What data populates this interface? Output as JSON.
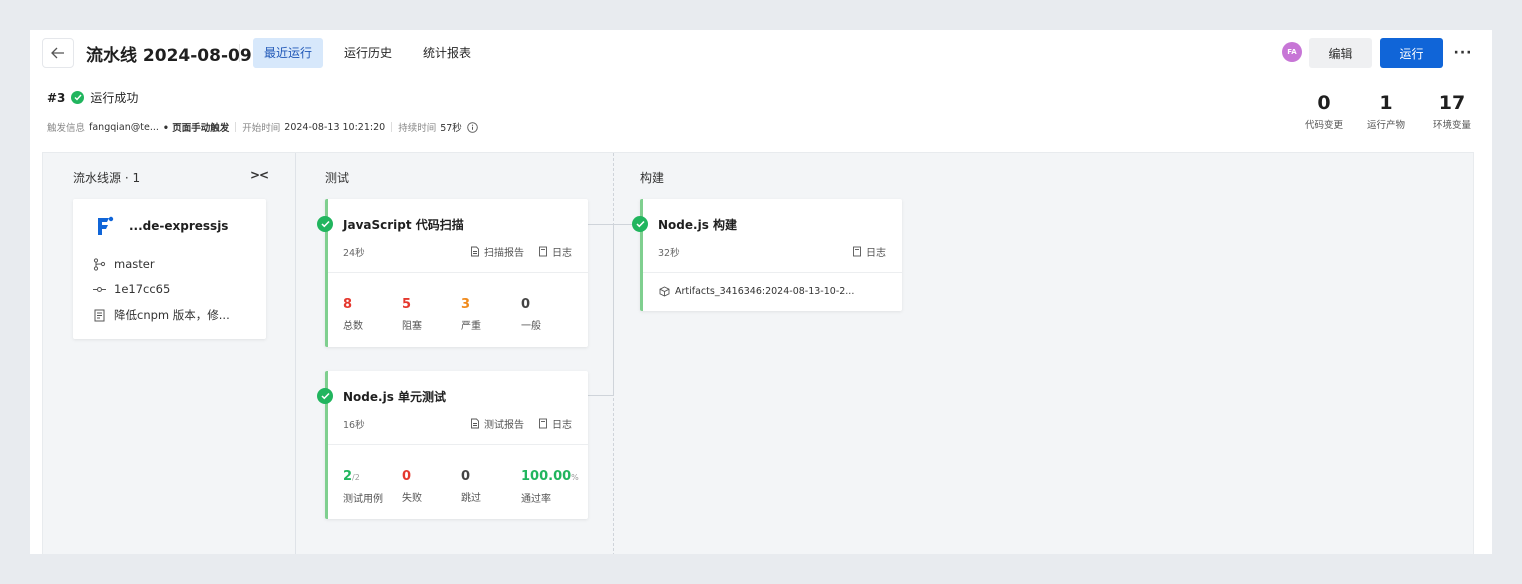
{
  "header": {
    "title": "流水线 2024-08-09",
    "tabs": [
      "最近运行",
      "运行历史",
      "统计报表"
    ],
    "avatar_initials": "FA",
    "edit_label": "编辑",
    "run_label": "运行",
    "more_label": "···"
  },
  "run": {
    "number": "#3",
    "status": "运行成功",
    "trigger_label": "触发信息",
    "trigger_user": "fangqian@te...",
    "trigger_type": "• 页面手动触发",
    "start_label": "开始时间",
    "start_time": "2024-08-13 10:21:20",
    "duration_label": "持续时间",
    "duration": "57秒"
  },
  "stats": [
    {
      "num": "0",
      "label": "代码变更"
    },
    {
      "num": "1",
      "label": "运行产物"
    },
    {
      "num": "17",
      "label": "环境变量"
    }
  ],
  "source": {
    "heading": "流水线源 · 1",
    "collapse": "><",
    "repo": "...de-expressjs",
    "branch": "master",
    "commit": "1e17cc65",
    "message": "降低cnpm 版本，修..."
  },
  "stages": {
    "test": {
      "heading": "测试",
      "js_scan": {
        "title": "JavaScript 代码扫描",
        "duration": "24秒",
        "report": "扫描报告",
        "log": "日志",
        "metrics": [
          {
            "n": "8",
            "t": "总数",
            "color": "#e5382e"
          },
          {
            "n": "5",
            "t": "阻塞",
            "color": "#e5382e"
          },
          {
            "n": "3",
            "t": "严重",
            "color": "#f08a1c"
          },
          {
            "n": "0",
            "t": "一般",
            "color": "#444444"
          }
        ]
      },
      "unit_test": {
        "title": "Node.js 单元测试",
        "duration": "16秒",
        "report": "测试报告",
        "log": "日志",
        "cases": "2",
        "cases_sub": "/2",
        "cases_label": "测试用例",
        "failed": "0",
        "failed_label": "失败",
        "skipped": "0",
        "skipped_label": "跳过",
        "pass_rate": "100.00",
        "pass_unit": "%",
        "pass_label": "通过率"
      }
    },
    "build": {
      "heading": "构建",
      "node_build": {
        "title": "Node.js 构建",
        "duration": "32秒",
        "log": "日志",
        "artifact": "Artifacts_3416346:2024-08-13-10-2..."
      }
    }
  },
  "colors": {
    "primary": "#1065d8",
    "success": "#21b55e",
    "danger": "#e5382e",
    "warning": "#f08a1c"
  }
}
